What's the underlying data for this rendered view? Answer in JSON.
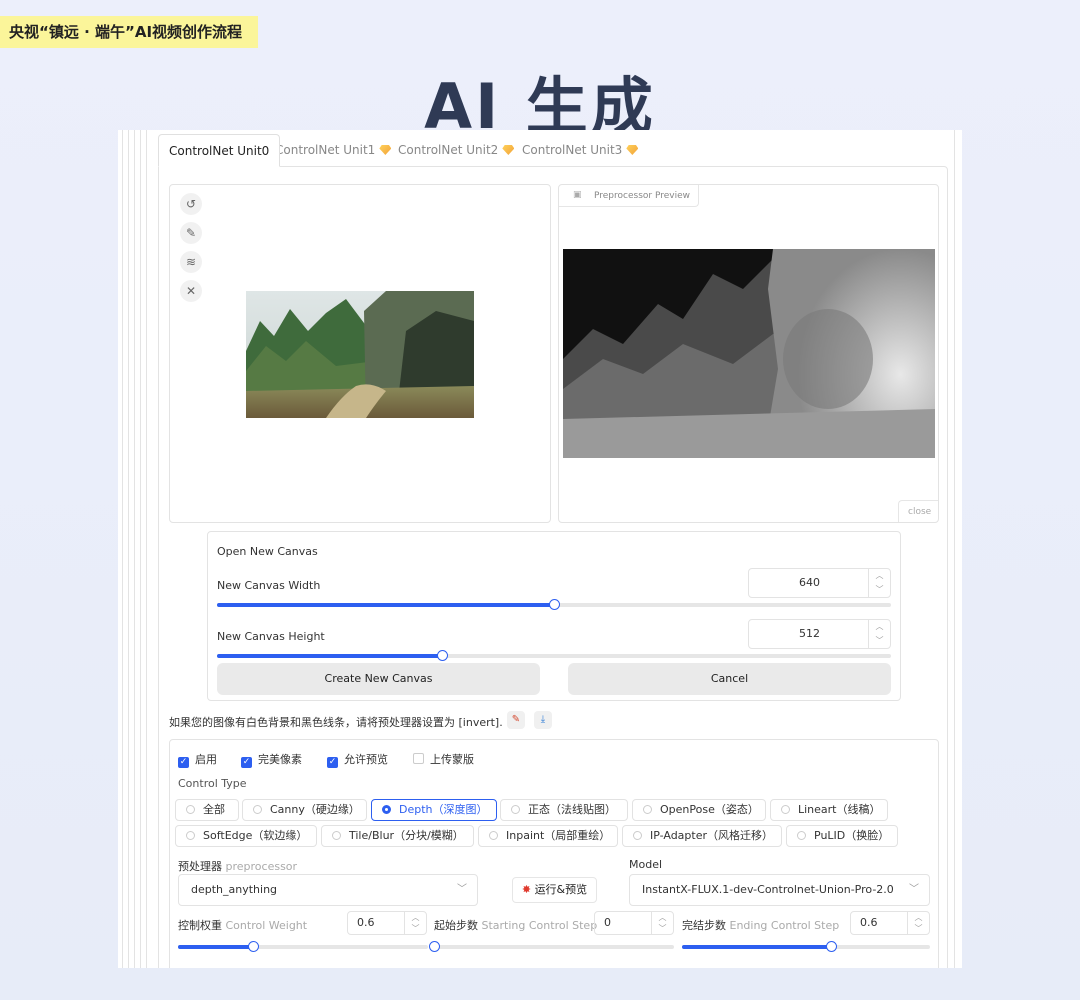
{
  "header": {
    "tag": "央视“镇远 · 端午”AI视频创作流程",
    "title": "AI 生成"
  },
  "tabs": [
    {
      "label": "ControlNet Unit0",
      "active": true
    },
    {
      "label": "ControlNet Unit1",
      "active": false
    },
    {
      "label": "ControlNet Unit2",
      "active": false
    },
    {
      "label": "ControlNet Unit3",
      "active": false
    }
  ],
  "image_panel": {
    "tools": [
      "undo-icon",
      "pencil-icon",
      "brush-clear-icon",
      "close-icon"
    ]
  },
  "preview_panel": {
    "label": "Preprocessor Preview",
    "close_label": "close"
  },
  "canvas": {
    "heading": "Open New Canvas",
    "width_label": "New Canvas Width",
    "width_value": "640",
    "width_fraction": 0.5,
    "height_label": "New Canvas Height",
    "height_value": "512",
    "height_fraction": 0.334,
    "create_label": "Create New Canvas",
    "cancel_label": "Cancel"
  },
  "invert_hint": "如果您的图像有白色背景和黑色线条，请将预处理器设置为 [invert].",
  "checks": [
    {
      "label": "启用",
      "checked": true
    },
    {
      "label": "完美像素",
      "checked": true
    },
    {
      "label": "允许预览",
      "checked": true
    },
    {
      "label": "上传蒙版",
      "checked": false
    }
  ],
  "control_type": {
    "label": "Control Type",
    "options_row1": [
      {
        "label": "全部",
        "selected": false
      },
      {
        "label": "Canny（硬边缘）",
        "selected": false
      },
      {
        "label": "Depth（深度图）",
        "selected": true
      },
      {
        "label": "正态（法线贴图）",
        "selected": false
      },
      {
        "label": "OpenPose（姿态）",
        "selected": false
      },
      {
        "label": "Lineart（线稿）",
        "selected": false
      }
    ],
    "options_row2": [
      {
        "label": "SoftEdge（软边缘）",
        "selected": false
      },
      {
        "label": "Tile/Blur（分块/模糊）",
        "selected": false
      },
      {
        "label": "Inpaint（局部重绘）",
        "selected": false
      },
      {
        "label": "IP-Adapter（风格迁移）",
        "selected": false
      },
      {
        "label": "PuLID（换脸）",
        "selected": false
      }
    ]
  },
  "preprocessor": {
    "label": "预处理器",
    "sublabel": "preprocessor",
    "value": "depth_anything",
    "run_label": "运行&预览"
  },
  "model": {
    "label": "Model",
    "value": "InstantX-FLUX.1-dev-Controlnet-Union-Pro-2.0"
  },
  "weights": {
    "control_weight": {
      "label": "控制权重",
      "sublabel": "Control Weight",
      "value": "0.6",
      "fraction": 0.3
    },
    "start_step": {
      "label": "起始步数",
      "sublabel": "Starting Control Step",
      "value": "0",
      "fraction": 0.0
    },
    "end_step": {
      "label": "完结步数",
      "sublabel": "Ending Control Step",
      "value": "0.6",
      "fraction": 0.6
    }
  },
  "colors": {
    "accent": "#2d5ff0",
    "tag_bg": "#fbf59a",
    "title": "#2f3a55"
  }
}
